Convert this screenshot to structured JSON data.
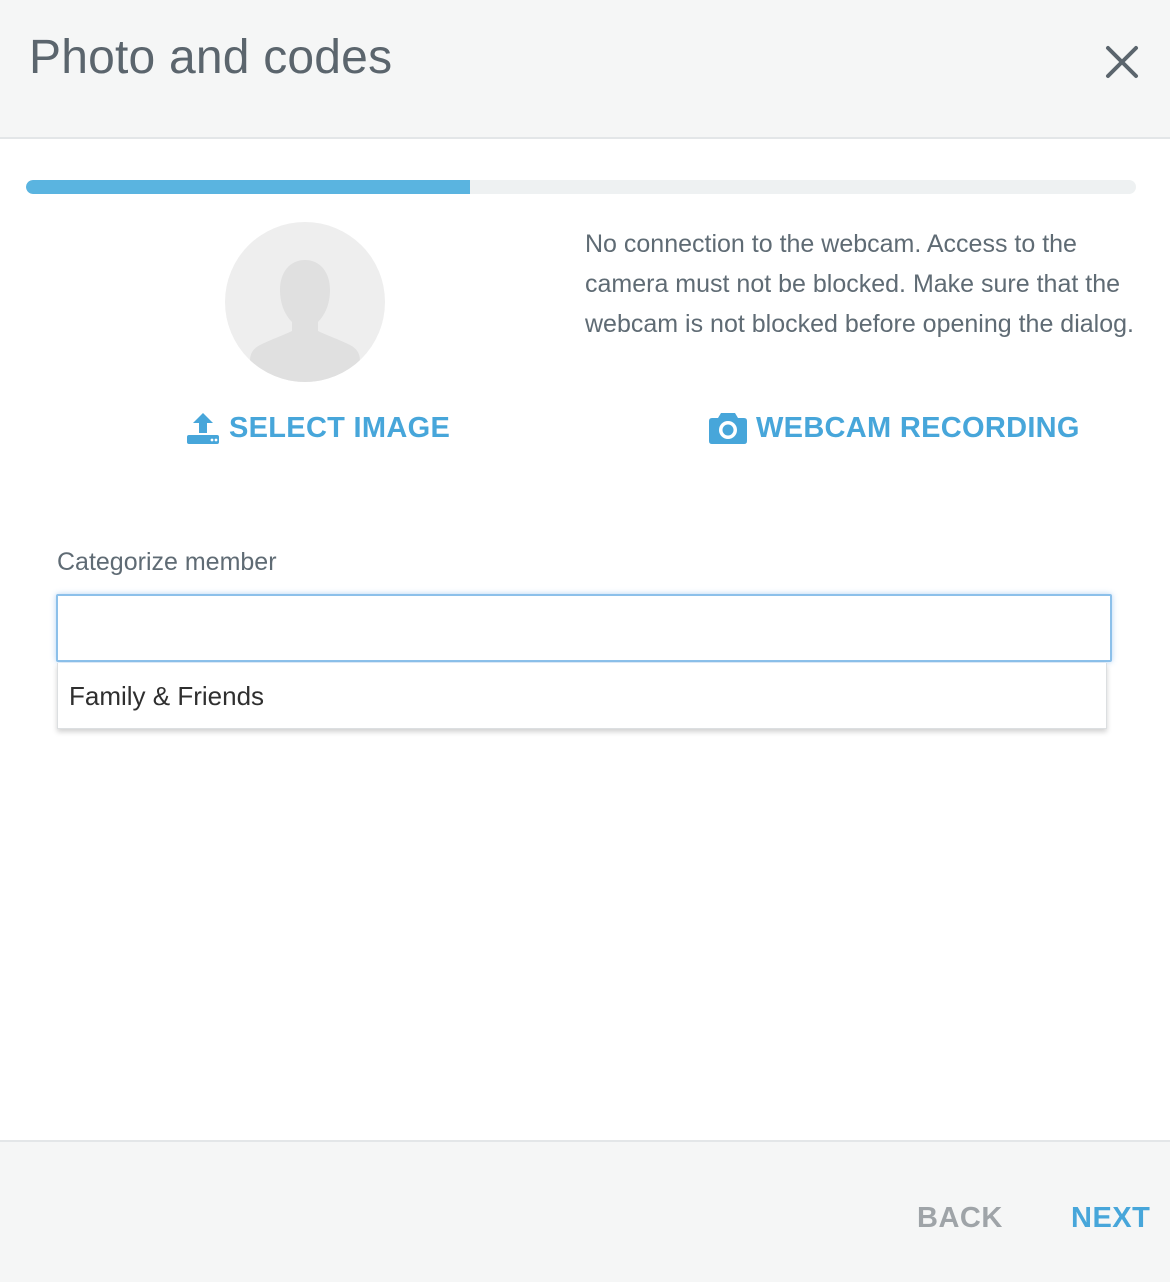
{
  "dialog": {
    "title": "Photo and codes",
    "close_icon": "close-icon"
  },
  "progress": {
    "fraction": 0.4
  },
  "photo": {
    "avatar_icon": "person-silhouette-icon",
    "webcam_message": "No connection to the webcam. Access to the camera must not be blocked. Make sure that the webcam is not blocked before opening the dialog.",
    "select_image_label": "SELECT IMAGE",
    "select_image_icon": "upload-icon",
    "webcam_label": "WEBCAM RECORDING",
    "webcam_icon": "camera-icon"
  },
  "category": {
    "label": "Categorize member",
    "value": "",
    "options": [
      "Family & Friends"
    ]
  },
  "footer": {
    "back_label": "BACK",
    "next_label": "NEXT"
  },
  "colors": {
    "accent": "#47a6da",
    "progress": "#5ab4e0",
    "disabled": "#9fa4a8"
  }
}
